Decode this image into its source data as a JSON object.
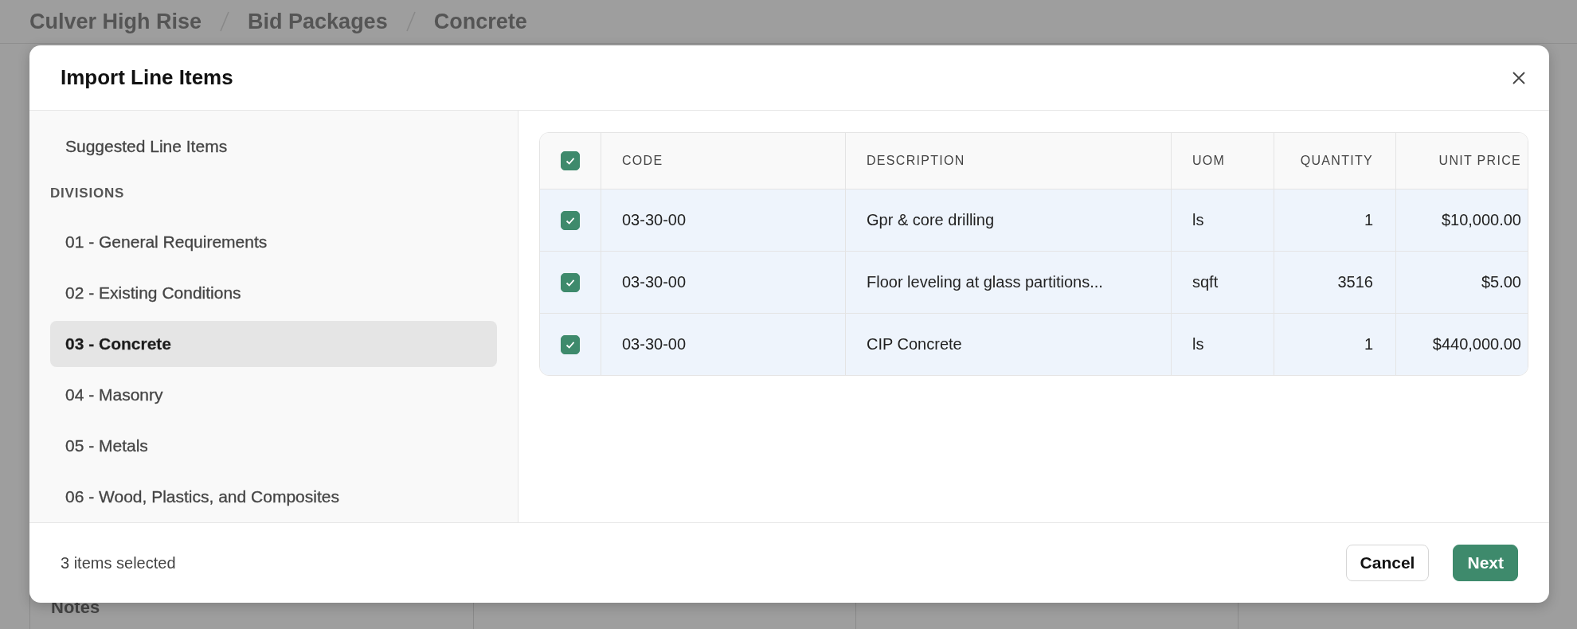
{
  "breadcrumb": [
    "Culver High Rise",
    "Bid Packages",
    "Concrete"
  ],
  "background": {
    "section_title": "Notes"
  },
  "dialog": {
    "title": "Import Line Items",
    "sidebar": {
      "top_item": {
        "label": "Suggested Line Items",
        "selected": false
      },
      "heading": "DIVISIONS",
      "items": [
        {
          "label": "01 - General Requirements",
          "selected": false
        },
        {
          "label": "02 - Existing Conditions",
          "selected": false
        },
        {
          "label": "03 - Concrete",
          "selected": true
        },
        {
          "label": "04 - Masonry",
          "selected": false
        },
        {
          "label": "05 - Metals",
          "selected": false
        },
        {
          "label": "06 - Wood, Plastics, and Composites",
          "selected": false
        }
      ]
    },
    "table": {
      "select_all_checked": true,
      "columns": [
        "CODE",
        "DESCRIPTION",
        "UOM",
        "QUANTITY",
        "UNIT PRICE"
      ],
      "rows": [
        {
          "checked": true,
          "code": "03-30-00",
          "description": "Gpr & core drilling",
          "uom": "ls",
          "quantity": "1",
          "unit_price": "$10,000.00"
        },
        {
          "checked": true,
          "code": "03-30-00",
          "description": "Floor leveling at glass partitions...",
          "uom": "sqft",
          "quantity": "3516",
          "unit_price": "$5.00"
        },
        {
          "checked": true,
          "code": "03-30-00",
          "description": "CIP Concrete",
          "uom": "ls",
          "quantity": "1",
          "unit_price": "$440,000.00"
        }
      ]
    },
    "footer": {
      "status": "3 items selected",
      "buttons": [
        {
          "label": "Cancel",
          "kind": "secondary"
        },
        {
          "label": "Next",
          "kind": "primary"
        }
      ]
    }
  }
}
